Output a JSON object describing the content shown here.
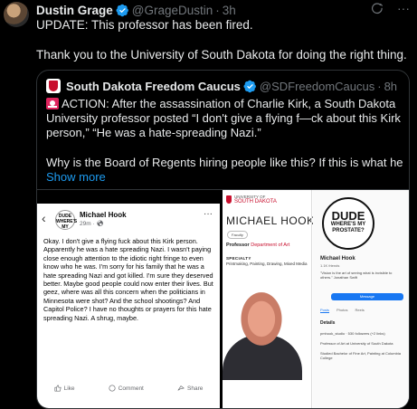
{
  "tweet": {
    "author_name": "Dustin Grage",
    "author_handle": "@GrageDustin",
    "separator": "·",
    "time": "3h",
    "line1": "UPDATE: This professor has been fired.",
    "line2": "Thank you to the University of South Dakota for doing the right thing."
  },
  "quote": {
    "author_name": "South Dakota Freedom Caucus",
    "author_handle": "@SDFreedomCaucus",
    "separator": "·",
    "time": "8h",
    "body": "ACTION: After the assassination of Charlie Kirk, a South Dakota University professor posted “I don't give a flying f—ck about this Kirk person,” “He was a hate-spreading Nazi.”",
    "body2": "Why is the Board of Regents hiring people like this? If this is what he ...",
    "show_more": "Show more"
  },
  "fb_post": {
    "logo_text": "DUDE WHERE'S MY PROSTATE?",
    "name": "Michael Hook",
    "time": "29m · ",
    "text": "Okay. I don't give a flying fuck about this Kirk person. Apparently he was a hate spreading Nazi. I wasn't paying close enough attention to the idiotic right fringe to even know who he was. I'm sorry for his family that he was a hate spreading Nazi and got killed. I'm sure they deserved better. Maybe good people could now enter their lives. But geez, where was all this concern when the politicians in Minnesota were shot? And the school shootings? And Capitol Police? I have no thoughts or prayers for this hate spreading Nazi. A shrug, maybe.",
    "like": "Like",
    "comment": "Comment",
    "share": "Share"
  },
  "profile": {
    "uni_line1": "UNIVERSITY OF",
    "uni_line2": "SOUTH DAKOTA",
    "name": "MICHAEL HOOK",
    "faculty": "Faculty",
    "role_label": "Professor",
    "role_dept": "Department of Art",
    "spec_label": "SPECIALTY",
    "spec_value": "Printmaking, Painting, Drawing, Mixed Media"
  },
  "social": {
    "logo_line1": "DUDE",
    "logo_line2": "WHERE'S MY",
    "logo_line3": "PROSTATE?",
    "handle": "Michael Hook",
    "followers": "1.1K friends",
    "bio": "\"Vision is the art of seeing what is invisible to others.\" Jonathan Swift",
    "message_btn": "Message",
    "tab_posts": "Posts",
    "tab_photos": "Photos",
    "tab_reels": "Reels",
    "details": "Details",
    "row1": "pmhook_studio · 530 followers (+2 links)",
    "row2": "Professor of Art at University of South Dakota",
    "row3": "Studied Bachelor of Fine Art, Painting at Columbia College"
  },
  "colors": {
    "accent": "#1d9bf0",
    "muted": "#71767b",
    "usd_red": "#c8102e"
  }
}
